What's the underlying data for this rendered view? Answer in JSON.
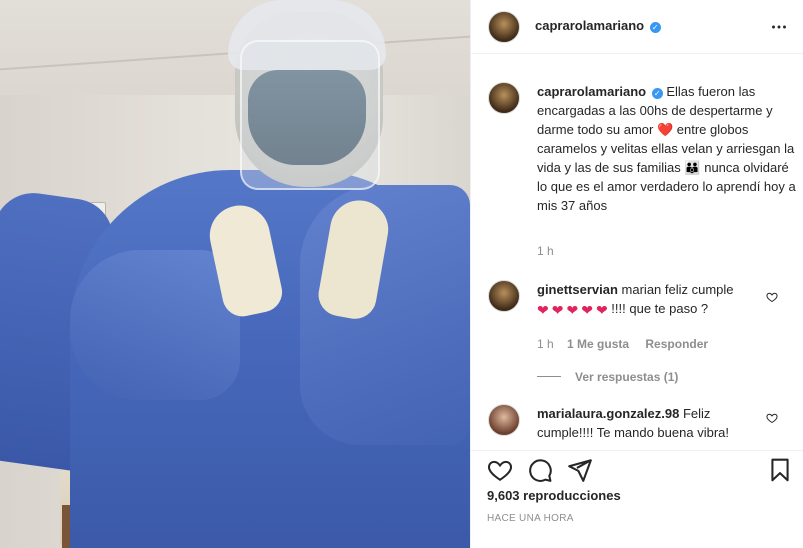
{
  "post": {
    "username": "caprarolamariano",
    "verified_mark": "✓",
    "more_icon": "more-horizontal-icon"
  },
  "caption": {
    "username": "caprarolamariano",
    "text_part1": "Ellas fueron las encargadas a las 00hs de despertarme y darme todo su amor",
    "heart_emoji": "❤️",
    "text_part2": "entre globos caramelos y velitas ellas velan y arriesgan la vida y las de sus familias",
    "family_emoji": "👪",
    "text_part3": "nunca olvidaré lo que es el amor verdadero lo aprendí hoy a mis 37 años",
    "time": "1 h"
  },
  "comments": [
    {
      "username": "ginettservian",
      "text_before": "marian feliz cumple",
      "hearts": [
        "❤",
        "❤",
        "❤",
        "❤",
        "❤"
      ],
      "text_after": "!!!! que te paso ?",
      "time": "1 h",
      "likes": "1 Me gusta",
      "reply_label": "Responder",
      "view_replies": "Ver respuestas (1)"
    },
    {
      "username": "marialaura.gonzalez.98",
      "text": "Feliz cumple!!!! Te mando buena vibra!"
    }
  ],
  "actions": {
    "like_icon": "heart-icon",
    "comment_icon": "comment-icon",
    "share_icon": "share-icon",
    "save_icon": "bookmark-icon",
    "views": "9,603 reproducciones",
    "posted_ago": "HACE UNA HORA"
  }
}
